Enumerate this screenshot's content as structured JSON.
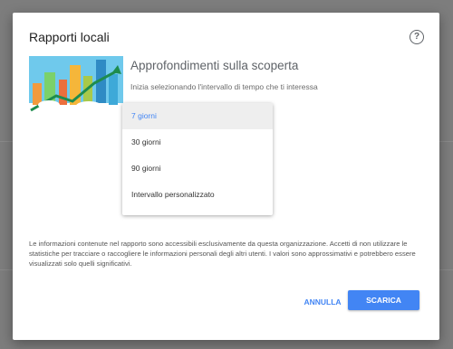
{
  "dialog": {
    "title": "Rapporti locali",
    "help_icon": "help-circle-icon",
    "heading": "Approfondimenti sulla scoperta",
    "subtext": "Inizia selezionando l'intervallo di tempo che ti interessa",
    "options": [
      {
        "label": "7 giorni",
        "selected": true
      },
      {
        "label": "30 giorni",
        "selected": false
      },
      {
        "label": "90 giorni",
        "selected": false
      },
      {
        "label": "Intervallo personalizzato",
        "selected": false
      }
    ],
    "disclaimer": "Le informazioni contenute nel rapporto sono accessibili esclusivamente da questa organizzazione. Accetti di non utilizzare le statistiche per tracciare o raccogliere le informazioni personali degli altri utenti. I valori sono approssimativi e potrebbero essere visualizzati solo quelli significativi.",
    "cancel_label": "ANNULLA",
    "download_label": "SCARICA"
  },
  "colors": {
    "accent": "#4285f4",
    "selected_bg": "#eeeeee",
    "overlay": "#7d7d7d"
  }
}
